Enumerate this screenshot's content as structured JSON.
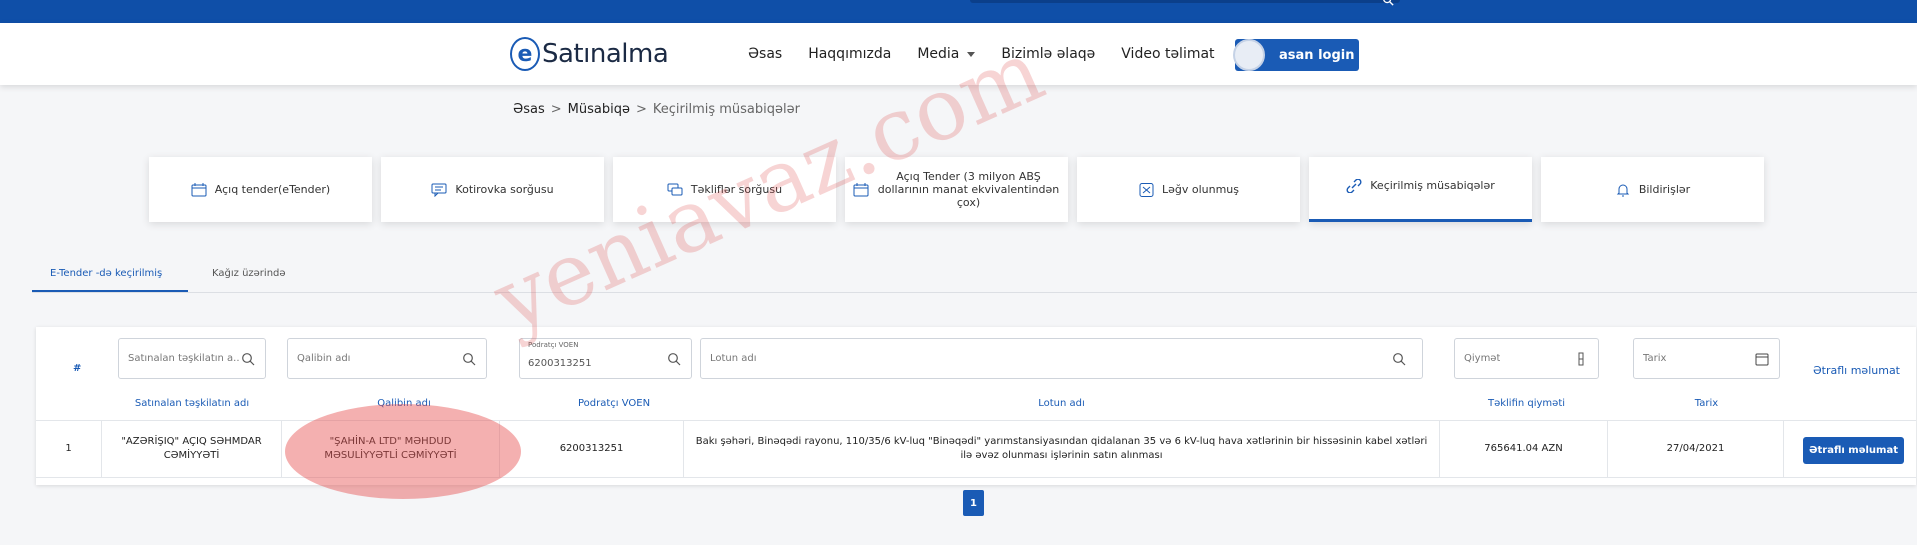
{
  "header": {
    "logo_text": "Satınalma",
    "logo_letter": "e",
    "nav": [
      "Əsas",
      "Haqqımızda",
      "Media",
      "Bizimlə əlaqə",
      "Video təlimat"
    ],
    "login_label": "asan login"
  },
  "breadcrumb": {
    "home": "Əsas",
    "sep1": ">",
    "level2": "Müsabiqə",
    "sep2": ">",
    "current": "Keçirilmiş müsabiqələr"
  },
  "categories": [
    {
      "label": "Açıq tender(eTender)",
      "icon": "calendar-icon"
    },
    {
      "label": "Kotirovka sorğusu",
      "icon": "chat-icon"
    },
    {
      "label": "Təkliflər sorğusu",
      "icon": "chat-bubbles-icon"
    },
    {
      "label": "Açıq Tender (3 milyon ABŞ dollarının manat ekvivalentindən çox)",
      "icon": "calendar-icon"
    },
    {
      "label": "Ləğv olunmuş",
      "icon": "cancel-icon"
    },
    {
      "label": "Keçirilmiş müsabiqələr",
      "icon": "link-icon"
    },
    {
      "label": "Bildirişlər",
      "icon": "bell-icon"
    }
  ],
  "subtabs": {
    "active": "E-Tender -də keçirilmiş",
    "other": "Kağız üzərində"
  },
  "filters": {
    "hash": "#",
    "org_placeholder": "Satınalan təşkilatın a...",
    "template_placeholder": "Qalibin adı",
    "voen_label": "Podratçı VOEN",
    "voen_value": "6200313251",
    "lot_placeholder": "Lotun adı",
    "price_placeholder": "Qiymət",
    "date_placeholder": "Tarix",
    "more_link": "Ətraflı məlumat"
  },
  "table": {
    "headers": [
      "Satınalan təşkilatın adı",
      "Qalibin adı",
      "Podratçı VOEN",
      "Lotun adı",
      "Təklifin qiyməti",
      "Tarix"
    ],
    "rows": [
      {
        "num": "1",
        "org": "\"AZƏRİŞIQ\" AÇIQ SƏHMDAR CƏMİYYƏTİ",
        "winner": "\"ŞAHİN-A LTD\" MƏHDUD MƏSULİYYƏTLİ CƏMİYYƏTİ",
        "voen": "6200313251",
        "lot": "Bakı şəhəri, Binəqədi rayonu, 110/35/6 kV-luq \"Binəqədi\" yarımstansiyasından qidalanan 35 və 6 kV-luq hava xətlərinin bir hissəsinin kabel xətləri ilə əvəz olunması işlərinin satın alınması",
        "price": "765641.04 AZN",
        "date": "27/04/2021",
        "button": "Ətraflı məlumat"
      }
    ]
  },
  "pagination": {
    "current": "1"
  },
  "watermark": "yeniavaz.com",
  "colors": {
    "primary": "#1a5bb5",
    "topbar": "#0f4fa8",
    "highlight": "#e65050"
  }
}
